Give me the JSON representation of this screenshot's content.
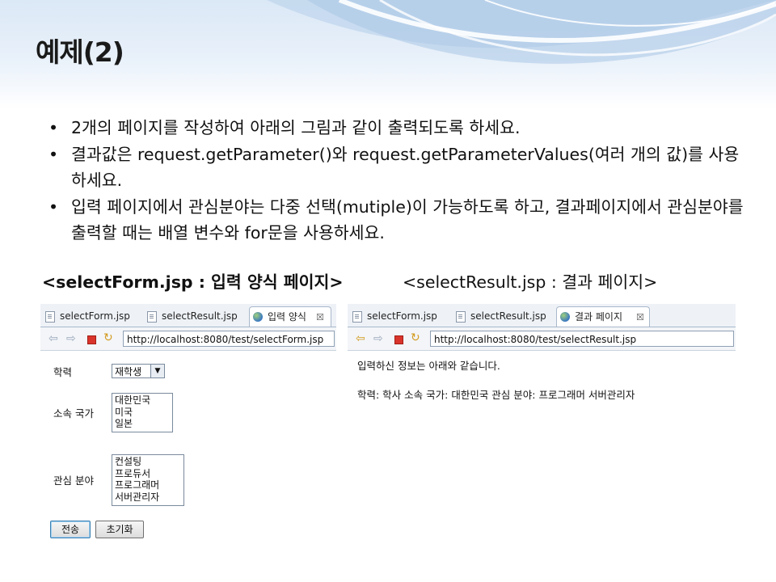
{
  "slide": {
    "title": "예제(2)",
    "bullets": [
      "2개의 페이지를 작성하여 아래의 그림과 같이 출력되도록 하세요.",
      "결과값은 request.getParameter()와 request.getParameterValues(여러 개의 값)를 사용하세요.",
      "입력 페이지에서 관심분야는 다중 선택(mutiple)이 가능하도록 하고, 결과페이지에서 관심분야를 출력할 때는 배열 변수와 for문을 사용하세요."
    ],
    "bullet_symbol": "•",
    "caption_left": "<selectForm.jsp : 입력 양식 페이지>",
    "caption_right": "<selectResult.jsp : 결과 페이지>"
  },
  "form_window": {
    "tabs": [
      "selectForm.jsp",
      "selectResult.jsp",
      "입력 양식"
    ],
    "close_glyph": "☒",
    "url": "http://localhost:8080/test/selectForm.jsp",
    "labels": {
      "education": "학력",
      "country": "소속 국가",
      "interest": "관심 분야"
    },
    "education_selected": "재학생",
    "country_options": [
      "대한민국",
      "미국",
      "일본"
    ],
    "interest_options": [
      "컨설팅",
      "프로듀서",
      "프로그래머",
      "서버관리자"
    ],
    "submit_label": "전송",
    "reset_label": "초기화"
  },
  "result_window": {
    "tabs": [
      "selectForm.jsp",
      "selectResult.jsp",
      "결과 페이지"
    ],
    "close_glyph": "☒",
    "url": "http://localhost:8080/test/selectResult.jsp",
    "line1": "입력하신 정보는 아래와 같습니다.",
    "line2": "학력: 학사 소속 국가: 대한민국 관심 분야: 프로그래머 서버관리자"
  },
  "toolbar_icons": [
    "back-arrow-icon",
    "forward-arrow-icon",
    "stop-icon",
    "refresh-icon"
  ],
  "colors": {
    "header_top": "#dbe8f6",
    "tab_border": "#a9b8cb",
    "stop_red": "#d9342b"
  }
}
